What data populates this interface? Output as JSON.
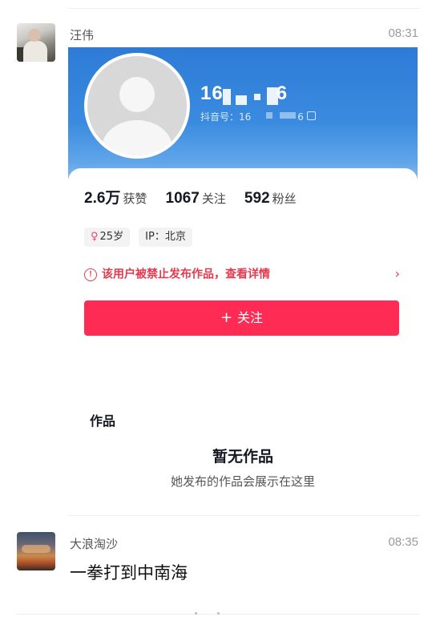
{
  "messages": [
    {
      "sender": "汪伟",
      "time": "08:31",
      "shared_profile": {
        "username": "16",
        "username_tail": "6",
        "douyin_id": "抖音号：16",
        "douyin_id_tail": "6",
        "stats": [
          {
            "num": "2.6万",
            "label": "获赞"
          },
          {
            "num": "1067",
            "label": "关注"
          },
          {
            "num": "592",
            "label": "粉丝"
          }
        ],
        "tags": {
          "age": "25岁",
          "ip": "IP：北京"
        },
        "warning": "该用户被禁止发布作品，查看详情",
        "follow_label": "关注",
        "works_title": "作品",
        "empty_title": "暂无作品",
        "empty_subtitle": "她发布的作品会展示在这里"
      }
    },
    {
      "sender": "大浪淘沙",
      "time": "08:35",
      "text": "一拳打到中南海"
    }
  ],
  "icons": {
    "female": "female-icon",
    "warning": "exclamation-circle-icon",
    "chevron": "chevron-right-icon",
    "plus": "plus-icon",
    "copy": "copy-icon"
  },
  "colors": {
    "accent_red": "#fe2c55",
    "warning_red": "#e33a4d",
    "banner_blue": "#2d7bd6"
  }
}
